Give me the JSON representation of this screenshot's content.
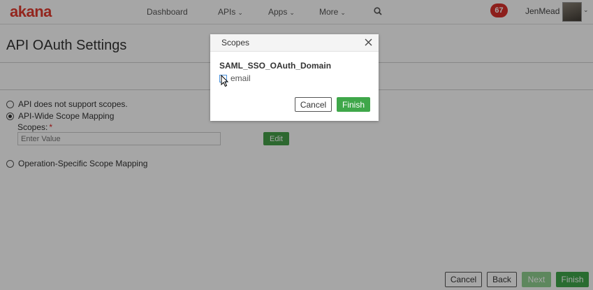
{
  "nav": {
    "logo": "akana",
    "items": [
      {
        "label": "Dashboard",
        "has_dropdown": false
      },
      {
        "label": "APIs",
        "has_dropdown": true
      },
      {
        "label": "Apps",
        "has_dropdown": true
      },
      {
        "label": "More",
        "has_dropdown": true
      }
    ],
    "search_icon": "search-icon",
    "notification_count": "67",
    "user_name": "JenMead",
    "brand_color": "#e23b2e",
    "badge_color": "#d9312b"
  },
  "page": {
    "title": "API OAuth Settings",
    "options": [
      {
        "label": "API does not support scopes.",
        "checked": false
      },
      {
        "label": "API-Wide Scope Mapping",
        "checked": true
      },
      {
        "label": "Operation-Specific Scope Mapping",
        "checked": false
      }
    ],
    "scopes_label": "Scopes:",
    "required_marker": "*",
    "scopes_placeholder": "Enter Value",
    "edit_label": "Edit"
  },
  "footer": {
    "cancel_label": "Cancel",
    "back_label": "Back",
    "next_label": "Next",
    "finish_label": "Finish",
    "next_disabled": true
  },
  "modal": {
    "title": "Scopes",
    "domain_name": "SAML_SSO_OAuth_Domain",
    "scope_items": [
      {
        "label": "email",
        "checked": false
      }
    ],
    "cancel_label": "Cancel",
    "finish_label": "Finish",
    "accent_color": "#3fa74a"
  }
}
